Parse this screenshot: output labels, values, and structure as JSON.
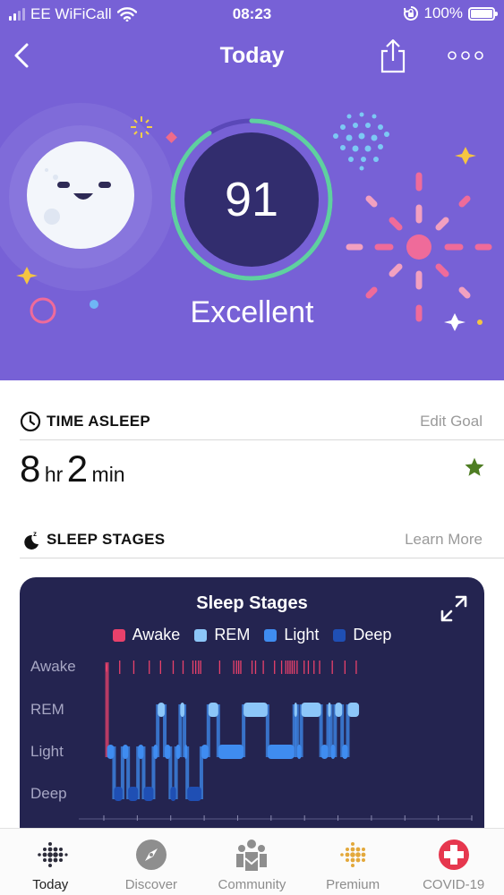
{
  "status_bar": {
    "carrier": "EE WiFiCall",
    "time": "08:23",
    "battery": "100%",
    "signal_bars_filled": 2,
    "signal_bars_total": 4
  },
  "nav": {
    "title": "Today",
    "back_icon": "chevron-left-icon",
    "share_icon": "share-icon",
    "more_icon": "more-dots-icon"
  },
  "sleep_score": {
    "value": "91",
    "rating": "Excellent",
    "progress_fraction": 0.91,
    "ring_color": "#5fd0a0"
  },
  "time_asleep": {
    "title": "TIME ASLEEP",
    "action": "Edit Goal",
    "hours": "8",
    "hours_unit": "hr",
    "minutes": "2",
    "minutes_unit": "min",
    "goal_icon": "star-icon",
    "goal_color": "#4e7d23"
  },
  "sleep_stages": {
    "title": "SLEEP STAGES",
    "action": "Learn More",
    "card_title": "Sleep Stages",
    "legend": [
      {
        "label": "Awake",
        "color": "#e8416b"
      },
      {
        "label": "REM",
        "color": "#8cc6f8"
      },
      {
        "label": "Light",
        "color": "#3f8cf0"
      },
      {
        "label": "Deep",
        "color": "#1f4fb4"
      }
    ],
    "y_labels": [
      "Awake",
      "REM",
      "Light",
      "Deep"
    ]
  },
  "chart_data": {
    "type": "line",
    "title": "Sleep Stages",
    "y_categories": [
      "Deep",
      "Light",
      "REM",
      "Awake"
    ],
    "x_unit": "minutes since sleep start",
    "x_range": [
      0,
      482
    ],
    "x_tick_count": 12,
    "series": [
      {
        "name": "Sleep stage",
        "segments": [
          {
            "start": 0,
            "end": 2,
            "stage": "Awake"
          },
          {
            "start": 2,
            "end": 12,
            "stage": "Light"
          },
          {
            "start": 12,
            "end": 24,
            "stage": "Deep"
          },
          {
            "start": 24,
            "end": 32,
            "stage": "Light"
          },
          {
            "start": 32,
            "end": 46,
            "stage": "Deep"
          },
          {
            "start": 46,
            "end": 54,
            "stage": "Light"
          },
          {
            "start": 54,
            "end": 68,
            "stage": "Deep"
          },
          {
            "start": 68,
            "end": 74,
            "stage": "Light"
          },
          {
            "start": 74,
            "end": 84,
            "stage": "REM"
          },
          {
            "start": 84,
            "end": 92,
            "stage": "Light"
          },
          {
            "start": 92,
            "end": 100,
            "stage": "Deep"
          },
          {
            "start": 100,
            "end": 106,
            "stage": "Light"
          },
          {
            "start": 106,
            "end": 112,
            "stage": "REM"
          },
          {
            "start": 112,
            "end": 116,
            "stage": "Light"
          },
          {
            "start": 116,
            "end": 136,
            "stage": "Deep"
          },
          {
            "start": 136,
            "end": 146,
            "stage": "Light"
          },
          {
            "start": 146,
            "end": 160,
            "stage": "REM"
          },
          {
            "start": 160,
            "end": 196,
            "stage": "Light"
          },
          {
            "start": 196,
            "end": 230,
            "stage": "REM"
          },
          {
            "start": 230,
            "end": 268,
            "stage": "Light"
          },
          {
            "start": 268,
            "end": 272,
            "stage": "REM"
          },
          {
            "start": 272,
            "end": 278,
            "stage": "Light"
          },
          {
            "start": 278,
            "end": 306,
            "stage": "REM"
          },
          {
            "start": 306,
            "end": 316,
            "stage": "Light"
          },
          {
            "start": 316,
            "end": 320,
            "stage": "REM"
          },
          {
            "start": 320,
            "end": 326,
            "stage": "Light"
          },
          {
            "start": 326,
            "end": 336,
            "stage": "REM"
          },
          {
            "start": 336,
            "end": 344,
            "stage": "Light"
          },
          {
            "start": 344,
            "end": 360,
            "stage": "REM"
          }
        ],
        "awake_marks_min": [
          20,
          40,
          62,
          78,
          96,
          110,
          124,
          128,
          132,
          135,
          162,
          182,
          186,
          189,
          192,
          208,
          213,
          224,
          240,
          250,
          256,
          259,
          262,
          265,
          268,
          272,
          282,
          288,
          296,
          304,
          322,
          340,
          356
        ]
      }
    ]
  },
  "tabs": [
    {
      "label": "Today",
      "icon": "fitbit-dots-icon",
      "active": true
    },
    {
      "label": "Discover",
      "icon": "compass-icon",
      "active": false
    },
    {
      "label": "Community",
      "icon": "community-icon",
      "active": false
    },
    {
      "label": "Premium",
      "icon": "premium-dots-icon",
      "active": false
    },
    {
      "label": "COVID-19",
      "icon": "medical-cross-icon",
      "active": false
    }
  ]
}
